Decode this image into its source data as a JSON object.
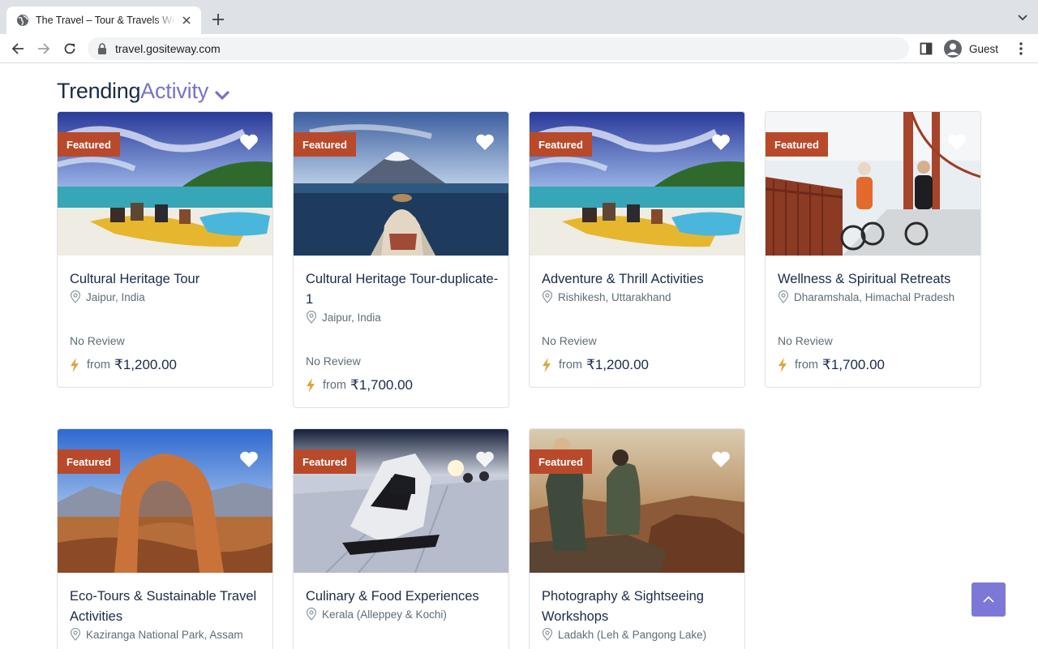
{
  "browser": {
    "tab_title": "The Travel – Tour & Travels Website",
    "url": "travel.gositeway.com",
    "profile_label": "Guest"
  },
  "section": {
    "title_main": "Trending",
    "title_accent": "Activity"
  },
  "colors": {
    "accent": "#7872c8",
    "badge": "#b84a2b",
    "scroll_button": "#7d78d8",
    "text_dark": "#1a2b49",
    "text_muted": "#5e6d77"
  },
  "cards": [
    {
      "badge": "Featured",
      "title": "Cultural Heritage Tour",
      "location": "Jaipur, India",
      "review": "No Review",
      "from": "from",
      "price": "₹1,200.00",
      "image": "beach-banana-boat"
    },
    {
      "badge": "Featured",
      "title": "Cultural Heritage Tour-duplicate-1",
      "location": "Jaipur, India",
      "review": "No Review",
      "from": "from",
      "price": "₹1,700.00",
      "image": "lake-mountain-canoe"
    },
    {
      "badge": "Featured",
      "title": "Adventure & Thrill Activities",
      "location": "Rishikesh, Uttarakhand",
      "review": "No Review",
      "from": "from",
      "price": "₹1,200.00",
      "image": "beach-banana-boat"
    },
    {
      "badge": "Featured",
      "title": "Wellness & Spiritual Retreats",
      "location": "Dharamshala, Himachal Pradesh",
      "review": "No Review",
      "from": "from",
      "price": "₹1,700.00",
      "image": "bridge-cyclists"
    },
    {
      "badge": "Featured",
      "title": "Eco-Tours & Sustainable Travel Activities",
      "location": "Kaziranga National Park, Assam",
      "image": "desert-arch"
    },
    {
      "badge": "Featured",
      "title": "Culinary & Food Experiences",
      "location": "Kerala (Alleppey & Kochi)",
      "image": "snowmobile"
    },
    {
      "badge": "Featured",
      "title": "Photography & Sightseeing Workshops",
      "location": "Ladakh (Leh & Pangong Lake)",
      "image": "canyon-photographers"
    }
  ]
}
